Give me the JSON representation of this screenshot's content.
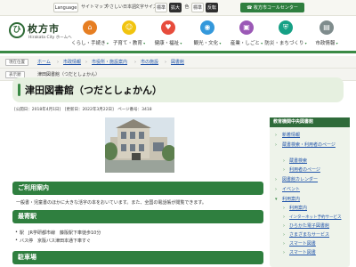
{
  "utility": {
    "language": "Language",
    "sitemap": "サイトマップ",
    "easy_japanese": "やさしい日本語",
    "text_size_label": "文字サイズ",
    "size_standard": "標準",
    "size_large": "拡大",
    "color_label": "色",
    "color_standard": "標準",
    "color_inverted": "反転",
    "call_center": "枚方市コールセンター"
  },
  "logo": {
    "mark": "ひ",
    "title": "枚方市",
    "subtitle": "Hirakata City ホームへ"
  },
  "nav": [
    {
      "label": "くらし・手続き",
      "icon": "house-icon",
      "color": "#e67e22",
      "glyph": "⌂"
    },
    {
      "label": "子育て・教育",
      "icon": "child-icon",
      "color": "#f1c40f",
      "glyph": "☺"
    },
    {
      "label": "健康・福祉",
      "icon": "heart-icon",
      "color": "#e74c3c",
      "glyph": "♥"
    },
    {
      "label": "観光・文化",
      "icon": "camera-icon",
      "color": "#3498db",
      "glyph": "◉"
    },
    {
      "label": "産業・しごと",
      "icon": "briefcase-icon",
      "color": "#9b59b6",
      "glyph": "▣"
    },
    {
      "label": "防災・まちづくり",
      "icon": "shield-icon",
      "color": "#16a085",
      "glyph": "⛨"
    },
    {
      "label": "市政情報",
      "icon": "building-icon",
      "color": "#7f8c8d",
      "glyph": "▤"
    }
  ],
  "breadcrumb": {
    "tag": "現在位置",
    "items": [
      "ホーム",
      "市政情報",
      "市役所・施設案内",
      "市の施設",
      "図書館"
    ],
    "tag2": "表示順",
    "current": "津田図書館（つだとしょかん）"
  },
  "page": {
    "title": "津田図書館（つだとしょかん）",
    "dates": "[公開日：2018年4月1日]　[更新日：2022年3月22日]　ページ番号：3418"
  },
  "sections": {
    "usage_title": "ご利用案内",
    "usage_text": "一般書・児童書のほかに大きな活字の本をおいています。また、全国の電話帳が閲覧できます。",
    "station_title": "最寄駅",
    "station_items": [
      "駅　JR学研都市線　藤阪駅下車徒歩10分",
      "バス停　京阪バス津田本通下車すぐ"
    ],
    "parking_title": "駐車場"
  },
  "sidebar": {
    "title": "教育機関中央図書館",
    "links": [
      {
        "label": "新着情報",
        "sub": false
      },
      {
        "label": "蔵書検索・利用者のページ",
        "sub": false
      },
      {
        "label": "蔵書検索",
        "sub": true
      },
      {
        "label": "利用者のページ",
        "sub": true
      },
      {
        "label": "図書館カレンダー",
        "sub": false
      },
      {
        "label": "イベント",
        "sub": false
      },
      {
        "label": "利用案内",
        "sub": false
      },
      {
        "label": "利用案内",
        "sub": true
      },
      {
        "label": "インターネット予約サービス",
        "sub": true
      },
      {
        "label": "ひらかた電子図書館",
        "sub": true
      },
      {
        "label": "さまざまなサービス",
        "sub": true
      },
      {
        "label": "スマート図書",
        "sub": true
      },
      {
        "label": "スマート図書",
        "sub": true
      }
    ]
  },
  "colors": {
    "brand_green": "#2f7f3f",
    "title_bg": "#e6f0e0",
    "link": "#2255aa"
  }
}
